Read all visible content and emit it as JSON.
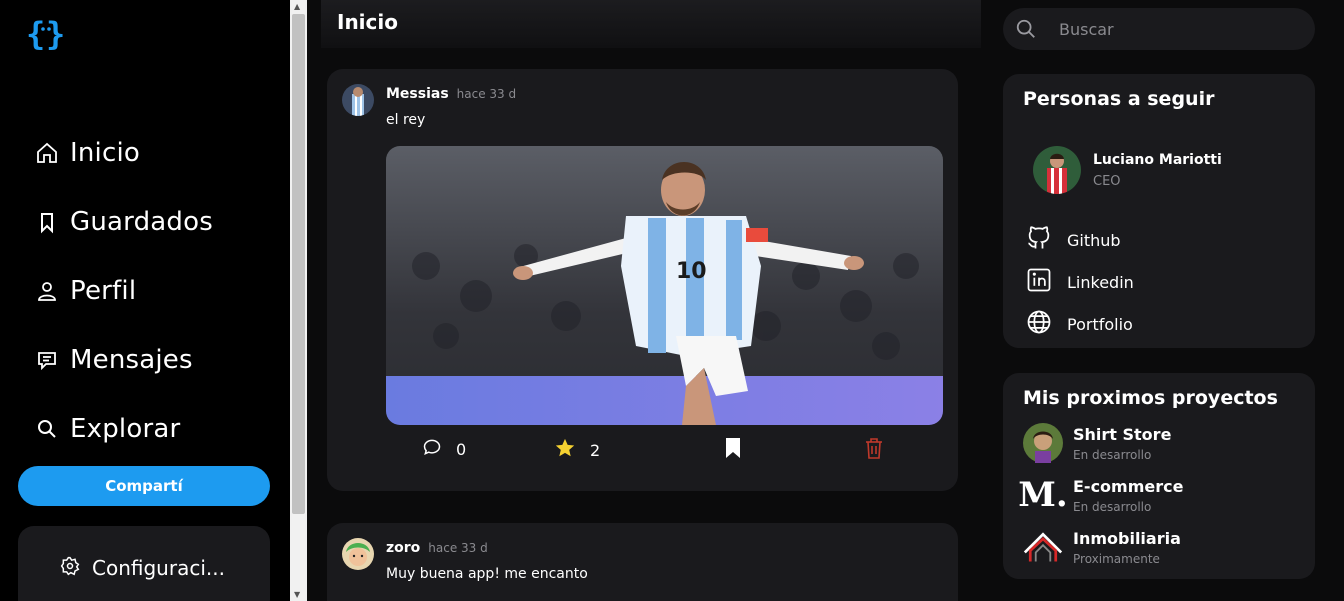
{
  "logo": {
    "alt": "{ }"
  },
  "sidebar": {
    "items": [
      {
        "label": "Inicio",
        "icon": "home-icon"
      },
      {
        "label": "Guardados",
        "icon": "bookmark-icon"
      },
      {
        "label": "Perfil",
        "icon": "user-icon"
      },
      {
        "label": "Mensajes",
        "icon": "message-icon"
      },
      {
        "label": "Explorar",
        "icon": "search-icon"
      }
    ],
    "share_label": "Compartí",
    "config_label": "Configuraci..."
  },
  "main": {
    "title": "Inicio",
    "posts": [
      {
        "author": "Messias",
        "time": "hace 33 d",
        "text": "el rey",
        "comments": "0",
        "stars": "2"
      },
      {
        "author": "zoro",
        "time": "hace 33 d",
        "text": "Muy buena app! me encanto"
      }
    ]
  },
  "search": {
    "placeholder": "Buscar"
  },
  "follow": {
    "title": "Personas a seguir",
    "person": {
      "name": "Luciano Mariotti",
      "role": "CEO"
    },
    "links": [
      {
        "label": "Github",
        "icon": "github-icon"
      },
      {
        "label": "Linkedin",
        "icon": "linkedin-icon"
      },
      {
        "label": "Portfolio",
        "icon": "globe-icon"
      }
    ]
  },
  "projects": {
    "title": "Mis proximos proyectos",
    "items": [
      {
        "name": "Shirt Store",
        "status": "En desarrollo"
      },
      {
        "name": "E-commerce",
        "status": "En desarrollo",
        "logo_text": "M."
      },
      {
        "name": "Inmobiliaria",
        "status": "Proximamente"
      }
    ]
  },
  "colors": {
    "accent": "#1d9bf0",
    "card": "#1a1a1d",
    "star": "#f5d131",
    "delete": "#c0392b"
  }
}
